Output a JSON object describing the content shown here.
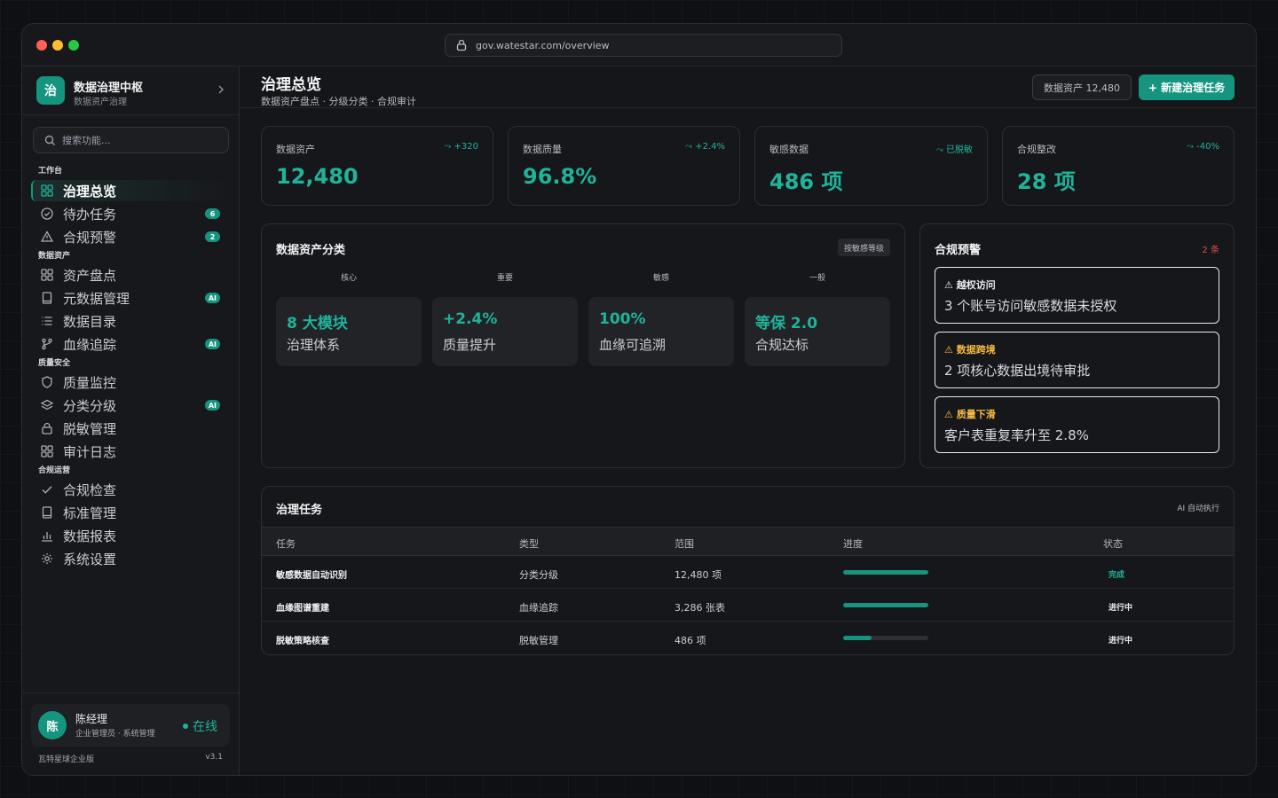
{
  "browser": {
    "url": "gov.watestar.com/overview"
  },
  "brand": {
    "logo_char": "治",
    "name": "数据治理中枢",
    "subtitle": "数据资产治理"
  },
  "search": {
    "placeholder": "搜索功能..."
  },
  "sidebar": {
    "sections": [
      {
        "title": "工作台"
      },
      {
        "title": "数据资产"
      },
      {
        "title": "质量安全"
      },
      {
        "title": "合规运营"
      }
    ],
    "items": [
      {
        "label": "治理总览",
        "icon": "grid-icon",
        "active": true
      },
      {
        "label": "待办任务",
        "icon": "check-circle-icon",
        "badge": "6"
      },
      {
        "label": "合规预警",
        "icon": "warning-icon",
        "badge": "2"
      },
      {
        "label": "资产盘点",
        "icon": "grid-icon"
      },
      {
        "label": "元数据管理",
        "icon": "book-icon",
        "badge": "AI"
      },
      {
        "label": "数据目录",
        "icon": "list-icon"
      },
      {
        "label": "血缘追踪",
        "icon": "branch-icon",
        "badge": "AI"
      },
      {
        "label": "质量监控",
        "icon": "shield-icon"
      },
      {
        "label": "分类分级",
        "icon": "layers-icon",
        "badge": "AI"
      },
      {
        "label": "脱敏管理",
        "icon": "lock-icon"
      },
      {
        "label": "审计日志",
        "icon": "grid-icon"
      },
      {
        "label": "合规检查",
        "icon": "check-icon"
      },
      {
        "label": "标准管理",
        "icon": "book-icon"
      },
      {
        "label": "数据报表",
        "icon": "bar-chart-icon"
      },
      {
        "label": "系统设置",
        "icon": "gear-icon"
      }
    ]
  },
  "user": {
    "avatar_char": "陈",
    "name": "陈经理",
    "role": "企业管理员 · 系统管理",
    "status": "在线"
  },
  "footer": {
    "edition": "瓦特星球企业版",
    "version": "v3.1"
  },
  "header": {
    "title": "治理总览",
    "subtitle": "数据资产盘点 · 分级分类 · 合规审计",
    "assets_button": "数据资产 12,480",
    "new_button": "+ 新建治理任务"
  },
  "stats": [
    {
      "label": "数据资产",
      "delta": "+320",
      "value": "12,480"
    },
    {
      "label": "数据质量",
      "delta": "+2.4%",
      "value": "96.8%"
    },
    {
      "label": "敏感数据",
      "delta": "已脱敏",
      "value": "486 项"
    },
    {
      "label": "合规整改",
      "delta": "-40%",
      "value": "28 项"
    }
  ],
  "classification": {
    "title": "数据资产分类",
    "tag": "按敏感等级",
    "tiers": [
      {
        "label": "核心",
        "value": "8 大模块",
        "desc": "治理体系"
      },
      {
        "label": "重要",
        "value": "+2.4%",
        "desc": "质量提升"
      },
      {
        "label": "敏感",
        "value": "100%",
        "desc": "血缘可追溯"
      },
      {
        "label": "一般",
        "value": "等保 2.0",
        "desc": "合规达标"
      }
    ]
  },
  "alerts": {
    "title": "合规预警",
    "count": "2 条",
    "items": [
      {
        "tag": "⚠ 越权访问",
        "text": "3 个账号访问敏感数据未授权",
        "color": "#e8eaed"
      },
      {
        "tag": "⚠ 数据跨境",
        "text": "2 项核心数据出境待审批",
        "color": "#f5b942"
      },
      {
        "tag": "⚠ 质量下滑",
        "text": "客户表重复率升至 2.8%",
        "color": "#f5b942"
      }
    ]
  },
  "tasks": {
    "title": "治理任务",
    "meta": "AI 自动执行",
    "columns": [
      "任务",
      "类型",
      "范围",
      "进度",
      "状态"
    ],
    "rows": [
      {
        "task": "敏感数据自动识别",
        "type": "分类分级",
        "scope": "12,480 项",
        "progress": 1.0,
        "status": "完成",
        "status_color": "#1fb39a"
      },
      {
        "task": "血缘图谱重建",
        "type": "血缘追踪",
        "scope": "3,286 张表",
        "progress": 1.0,
        "status": "进行中",
        "status_color": "#e8eaed"
      },
      {
        "task": "脱敏策略核查",
        "type": "脱敏管理",
        "scope": "486 项",
        "progress": 0.33,
        "status": "进行中",
        "status_color": "#e8eaed"
      }
    ]
  },
  "colors": {
    "accent": "#15957f",
    "accent_text": "#1fb39a",
    "warning": "#f5b942",
    "danger": "#e5484d"
  }
}
